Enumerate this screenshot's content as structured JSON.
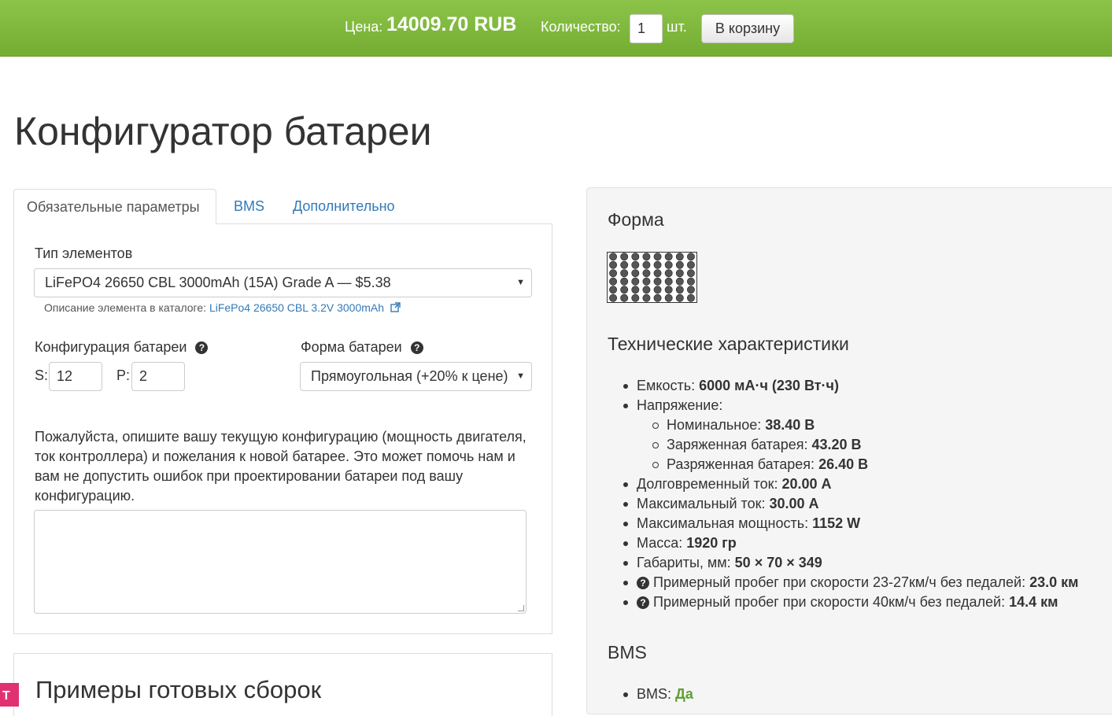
{
  "topbar": {
    "price_label": "Цена:",
    "price_value": "14009.70 RUB",
    "qty_label": "Количество:",
    "qty_value": "1",
    "qty_unit": "шт.",
    "cart_button": "В корзину",
    "bg_color": "#7ab83a"
  },
  "page_title": "Конфигуратор батареи",
  "tabs": [
    {
      "label": "Обязательные параметры",
      "active": true
    },
    {
      "label": "BMS",
      "active": false
    },
    {
      "label": "Дополнительно",
      "active": false
    }
  ],
  "form": {
    "cell_type_label": "Тип элементов",
    "cell_type_value": "LiFePO4 26650 CBL 3000mAh (15A) Grade A — $5.38",
    "catalog_help_prefix": "Описание элемента в каталоге:",
    "catalog_link": "LiFePo4 26650 CBL 3.2V 3000mAh",
    "config_label": "Конфигурация батареи",
    "s_label": "S:",
    "s_value": "12",
    "p_label": "P:",
    "p_value": "2",
    "shape_label": "Форма батареи",
    "shape_value": "Прямоугольная (+20% к цене)",
    "description": "Пожалуйста, опишите вашу текущую конфигурацию (мощность двигателя, ток контроллера) и пожелания к новой батарее. Это может помочь нам и вам не допустить ошибок при проектировании батареи под вашу конфигурацию.",
    "description_value": ""
  },
  "examples": {
    "title": "Примеры готовых сборок"
  },
  "right": {
    "shape_title": "Форма",
    "shape_grid": {
      "rows": 6,
      "cols": 8
    },
    "specs_title": "Технические характеристики",
    "specs": {
      "capacity_label": "Емкость:",
      "capacity_value": "6000 мА·ч (230 Вт·ч)",
      "voltage_label": "Напряжение:",
      "nominal_label": "Номинальное:",
      "nominal_value": "38.40 В",
      "charged_label": "Заряженная батарея:",
      "charged_value": "43.20 В",
      "discharged_label": "Разряженная батарея:",
      "discharged_value": "26.40 В",
      "cont_current_label": "Долговременный ток:",
      "cont_current_value": "20.00 А",
      "max_current_label": "Максимальный ток:",
      "max_current_value": "30.00 А",
      "max_power_label": "Максимальная мощность:",
      "max_power_value": "1152 W",
      "mass_label": "Масса:",
      "mass_value": "1920 гр",
      "dims_label": "Габариты, мм:",
      "dims_value": "50 × 70 × 349",
      "range1_label": "Примерный пробег при скорости 23-27км/ч без педалей:",
      "range1_value": "23.0 км",
      "range2_label": "Примерный пробег при скорости 40км/ч без педалей:",
      "range2_value": "14.4 км"
    },
    "bms_title": "BMS",
    "bms_label": "BMS:",
    "bms_value": "Да"
  },
  "corner_badge": "T"
}
